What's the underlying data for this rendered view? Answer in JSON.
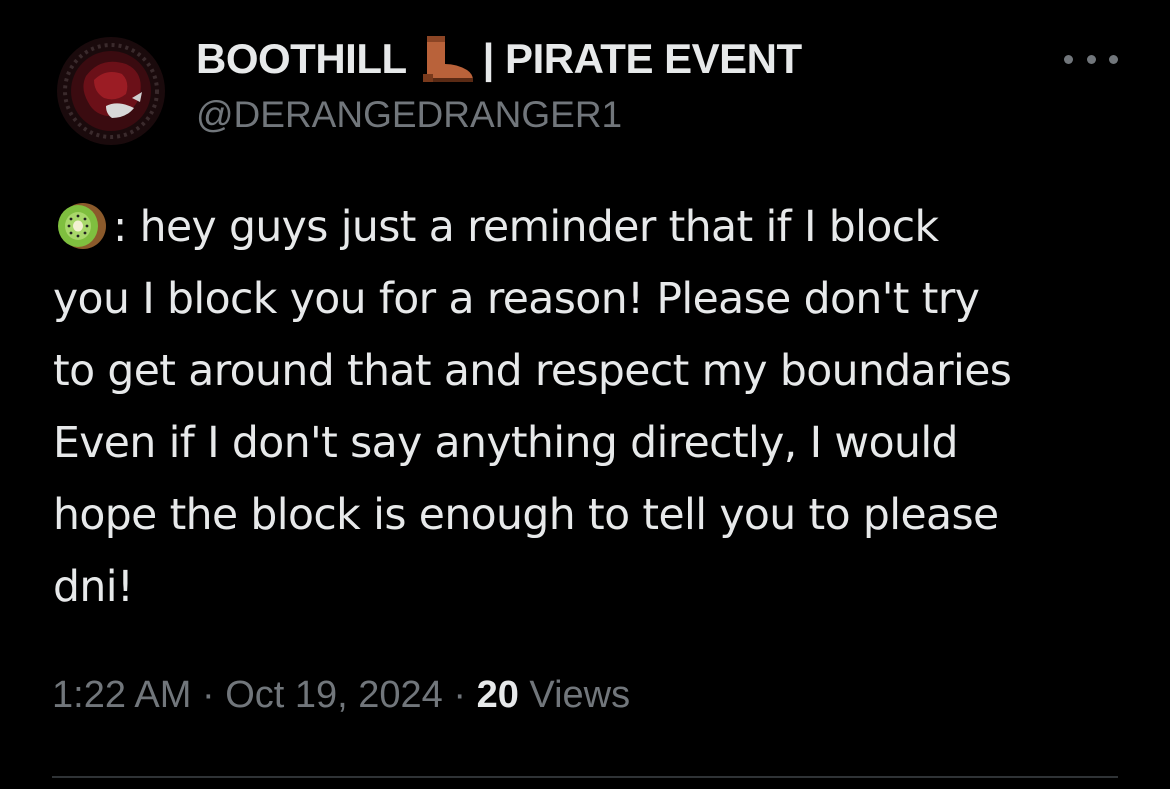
{
  "author": {
    "name_part1": "BOOTHILL",
    "boot_icon": "boot-icon",
    "name_part2": "| PIRATE EVENT",
    "handle": "@DERANGEDRANGER1",
    "avatar": "profile-avatar"
  },
  "more_icon": "more-options-icon",
  "tweet": {
    "kiwi_icon": "kiwi-emoji-icon",
    "lines": [
      ": hey guys just a reminder that if I block",
      "you I block you for a reason! Please don't try",
      "to get around that and respect my boundaries",
      "Even if I don't say anything directly, I would",
      "hope the block is enough to tell you to please",
      "dni!"
    ]
  },
  "meta": {
    "time": "1:22 AM",
    "separator": "·",
    "date": "Oct 19, 2024",
    "views_count": "20",
    "views_label": "Views"
  },
  "colors": {
    "background": "#000000",
    "text": "#e7e9ea",
    "secondary": "#71767b",
    "divider": "#2f3336"
  }
}
